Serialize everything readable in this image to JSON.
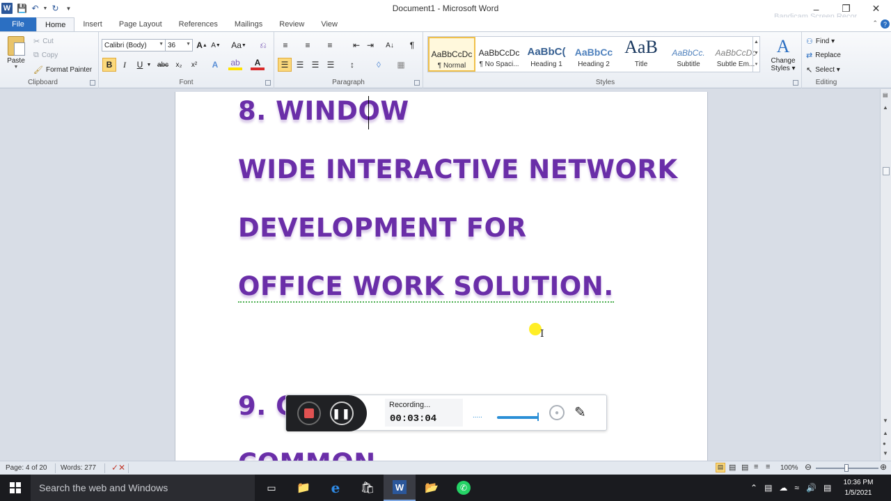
{
  "window": {
    "title": "Document1 - Microsoft Word",
    "watermark": "Bandicam Screen Recor"
  },
  "tabs": [
    "File",
    "Home",
    "Insert",
    "Page Layout",
    "References",
    "Mailings",
    "Review",
    "View"
  ],
  "clipboard": {
    "paste": "Paste",
    "cut": "Cut",
    "copy": "Copy",
    "format_painter": "Format Painter",
    "label": "Clipboard"
  },
  "font": {
    "name": "Calibri (Body)",
    "size": "36",
    "label": "Font",
    "grow": "A",
    "shrink": "A",
    "change_case": "Aa",
    "bold": "B",
    "italic": "I",
    "underline": "U",
    "strike": "abc",
    "subscript": "x₂",
    "superscript": "x²"
  },
  "paragraph": {
    "label": "Paragraph",
    "pilcrow": "¶"
  },
  "styles": {
    "label": "Styles",
    "items": [
      {
        "sample": "AaBbCcDc",
        "name": "¶ Normal"
      },
      {
        "sample": "AaBbCcDc",
        "name": "¶ No Spaci..."
      },
      {
        "sample": "AaBbC(",
        "name": "Heading 1"
      },
      {
        "sample": "AaBbCc",
        "name": "Heading 2"
      },
      {
        "sample": "AaB",
        "name": "Title"
      },
      {
        "sample": "AaBbCc.",
        "name": "Subtitle"
      },
      {
        "sample": "AaBbCcDc",
        "name": "Subtle Em..."
      }
    ],
    "change_styles_line1": "Change",
    "change_styles_line2": "Styles ▾"
  },
  "editing": {
    "label": "Editing",
    "find": "Find ▾",
    "replace": "Replace",
    "select": "Select ▾"
  },
  "document": {
    "lines": [
      "8. WINDOW",
      "WIDE INTERACTIVE NETWORK",
      "DEVELOPMENT FOR",
      "OFFICE WORK SOLUTION.",
      "9. C",
      "COMMON"
    ]
  },
  "recorder": {
    "status": "Recording...",
    "time": "00:03:04",
    "dots": "....."
  },
  "statusbar": {
    "page": "Page: 4 of 20",
    "words": "Words: 277",
    "zoom": "100%"
  },
  "taskbar": {
    "search_placeholder": "Search the web and Windows",
    "time": "10:36 PM",
    "date": "1/5/2021"
  },
  "colors": {
    "heading_text": "#6a2ea8",
    "file_tab": "#2b6fc2",
    "taskbar": "#1a1b1f"
  }
}
